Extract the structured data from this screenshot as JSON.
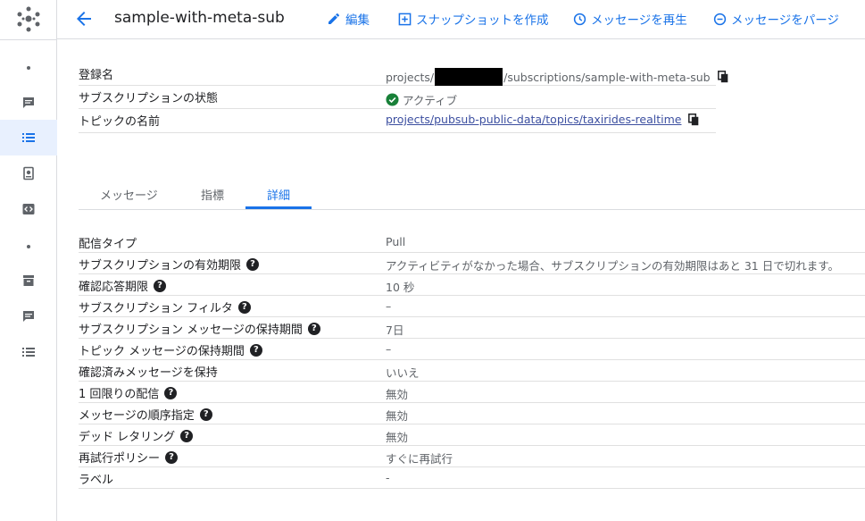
{
  "header": {
    "title": "sample-with-meta-sub",
    "actions": {
      "edit": "編集",
      "snapshot": "スナップショットを作成",
      "replay": "メッセージを再生",
      "purge": "メッセージをパージ"
    }
  },
  "info": {
    "rows": [
      {
        "key": "登録名",
        "value_prefix": "projects/",
        "value_suffix": "/subscriptions/sample-with-meta-sub"
      },
      {
        "key": "サブスクリプションの状態",
        "value": "アクティブ"
      },
      {
        "key": "トピックの名前",
        "value": "projects/pubsub-public-data/topics/taxirides-realtime"
      }
    ]
  },
  "tabs": [
    "メッセージ",
    "指標",
    "詳細"
  ],
  "details": [
    {
      "key": "配信タイプ",
      "value": "Pull"
    },
    {
      "key": "サブスクリプションの有効期限",
      "value": "アクティビティがなかった場合、サブスクリプションの有効期限はあと 31 日で切れます。"
    },
    {
      "key": "確認応答期限",
      "value": "10 秒"
    },
    {
      "key": "サブスクリプション フィルタ",
      "value": "–"
    },
    {
      "key": "サブスクリプション メッセージの保持期間",
      "value": "7日"
    },
    {
      "key": "トピック メッセージの保持期間",
      "value": "–"
    },
    {
      "key": "確認済みメッセージを保持",
      "value": "いいえ"
    },
    {
      "key": "1 回限りの配信",
      "value": "無効"
    },
    {
      "key": "メッセージの順序指定",
      "value": "無効"
    },
    {
      "key": "デッド レタリング",
      "value": "無効"
    },
    {
      "key": "再試行ポリシー",
      "value": "すぐに再試行"
    },
    {
      "key": "ラベル",
      "value": "-"
    }
  ],
  "help_glyph": "?",
  "colors": {
    "accent": "#1a73e8",
    "success": "#188038"
  }
}
